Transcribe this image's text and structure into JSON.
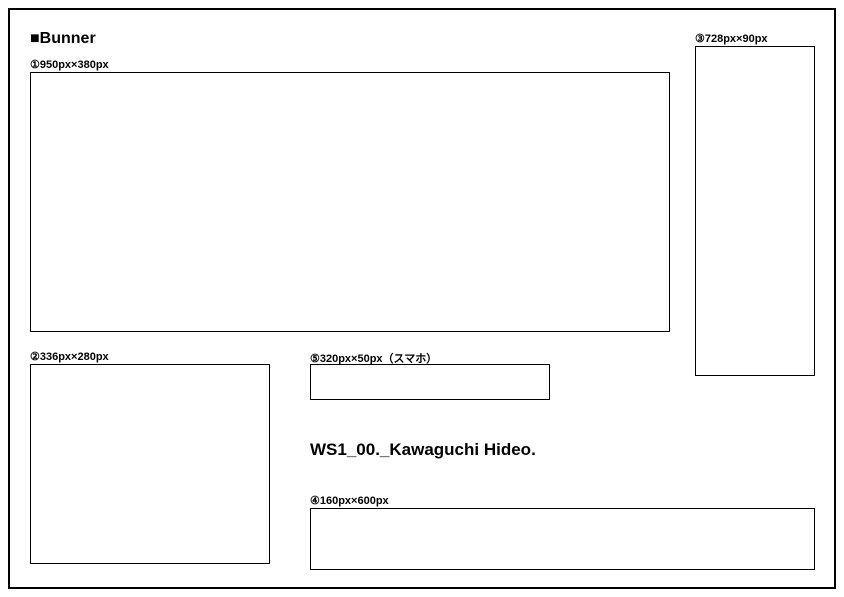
{
  "section_title": "■Bunner",
  "labels": {
    "b1": "①950px×380px",
    "b2": "②336px×280px",
    "b3": "③728px×90px",
    "b4": "④160px×600px",
    "b5": "⑤320px×50px（スマホ）"
  },
  "doc_title": "WS1_00._Kawaguchi Hideo."
}
